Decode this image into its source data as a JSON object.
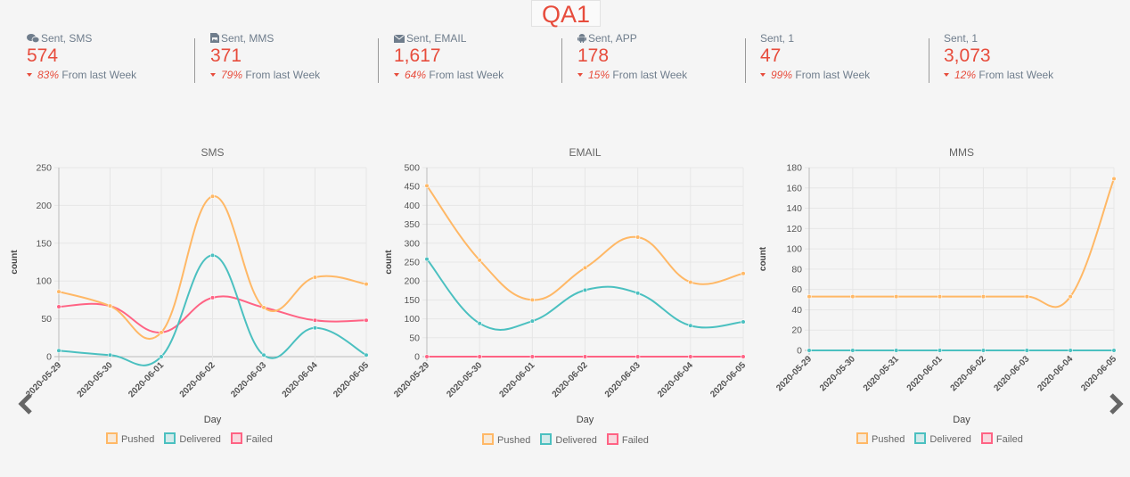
{
  "page": {
    "title": "QA1"
  },
  "stats": [
    {
      "icon": "wechat-icon",
      "label": "Sent, SMS",
      "value": "574",
      "change_pct": "83%",
      "change_text": "From last Week"
    },
    {
      "icon": "file-image-icon",
      "label": "Sent, MMS",
      "value": "371",
      "change_pct": "79%",
      "change_text": "From last Week"
    },
    {
      "icon": "envelope-icon",
      "label": "Sent, EMAIL",
      "value": "1,617",
      "change_pct": "64%",
      "change_text": "From last Week"
    },
    {
      "icon": "android-icon",
      "label": "Sent, APP",
      "value": "178",
      "change_pct": "15%",
      "change_text": "From last Week"
    },
    {
      "icon": "",
      "label": "Sent, 1",
      "value": "47",
      "change_pct": "99%",
      "change_text": "From last Week"
    },
    {
      "icon": "",
      "label": "Sent, 1",
      "value": "3,073",
      "change_pct": "12%",
      "change_text": "From last Week"
    }
  ],
  "colors": {
    "accent": "#e74c3c",
    "pushed": "#ffb866",
    "delivered": "#4bc0c0",
    "failed": "#ff6384"
  },
  "chart_data": [
    {
      "type": "line",
      "title": "SMS",
      "xlabel": "Day",
      "ylabel": "count",
      "ylim": [
        0,
        250
      ],
      "yticks": [
        0,
        50,
        100,
        150,
        200,
        250
      ],
      "x": [
        "2020-05-29",
        "2020-05-30",
        "2020-06-01",
        "2020-06-02",
        "2020-06-03",
        "2020-06-04",
        "2020-06-05"
      ],
      "series": [
        {
          "name": "Pushed",
          "values": [
            86,
            67,
            32,
            212,
            65,
            105,
            96
          ]
        },
        {
          "name": "Delivered",
          "values": [
            8,
            2,
            0,
            134,
            2,
            38,
            2
          ]
        },
        {
          "name": "Failed",
          "values": [
            66,
            67,
            32,
            78,
            65,
            48,
            48
          ]
        }
      ],
      "legend": "bottom",
      "grid": true
    },
    {
      "type": "line",
      "title": "EMAIL",
      "xlabel": "Day",
      "ylabel": "count",
      "ylim": [
        0,
        500
      ],
      "yticks": [
        0,
        50,
        100,
        150,
        200,
        250,
        300,
        350,
        400,
        450,
        500
      ],
      "x": [
        "2020-05-29",
        "2020-05-30",
        "2020-06-01",
        "2020-06-02",
        "2020-06-03",
        "2020-06-04",
        "2020-06-05"
      ],
      "series": [
        {
          "name": "Pushed",
          "values": [
            452,
            255,
            150,
            235,
            316,
            197,
            220
          ]
        },
        {
          "name": "Delivered",
          "values": [
            258,
            88,
            94,
            176,
            168,
            82,
            92
          ]
        },
        {
          "name": "Failed",
          "values": [
            0,
            0,
            0,
            0,
            0,
            0,
            0
          ]
        }
      ],
      "legend": "bottom",
      "grid": true
    },
    {
      "type": "line",
      "title": "MMS",
      "xlabel": "Day",
      "ylabel": "count",
      "ylim": [
        0,
        180
      ],
      "yticks": [
        0,
        20,
        40,
        60,
        80,
        100,
        120,
        140,
        160,
        180
      ],
      "x": [
        "2020-05-29",
        "2020-05-30",
        "2020-05-31",
        "2020-06-01",
        "2020-06-02",
        "2020-06-03",
        "2020-06-04",
        "2020-06-05"
      ],
      "series": [
        {
          "name": "Pushed",
          "values": [
            53,
            53,
            53,
            53,
            53,
            53,
            53,
            169
          ]
        },
        {
          "name": "Delivered",
          "values": [
            0,
            0,
            0,
            0,
            0,
            0,
            0,
            0
          ]
        },
        {
          "name": "Failed",
          "values": [
            0,
            0,
            0,
            0,
            0,
            0,
            0,
            0
          ]
        }
      ],
      "legend": "bottom",
      "grid": true
    }
  ]
}
